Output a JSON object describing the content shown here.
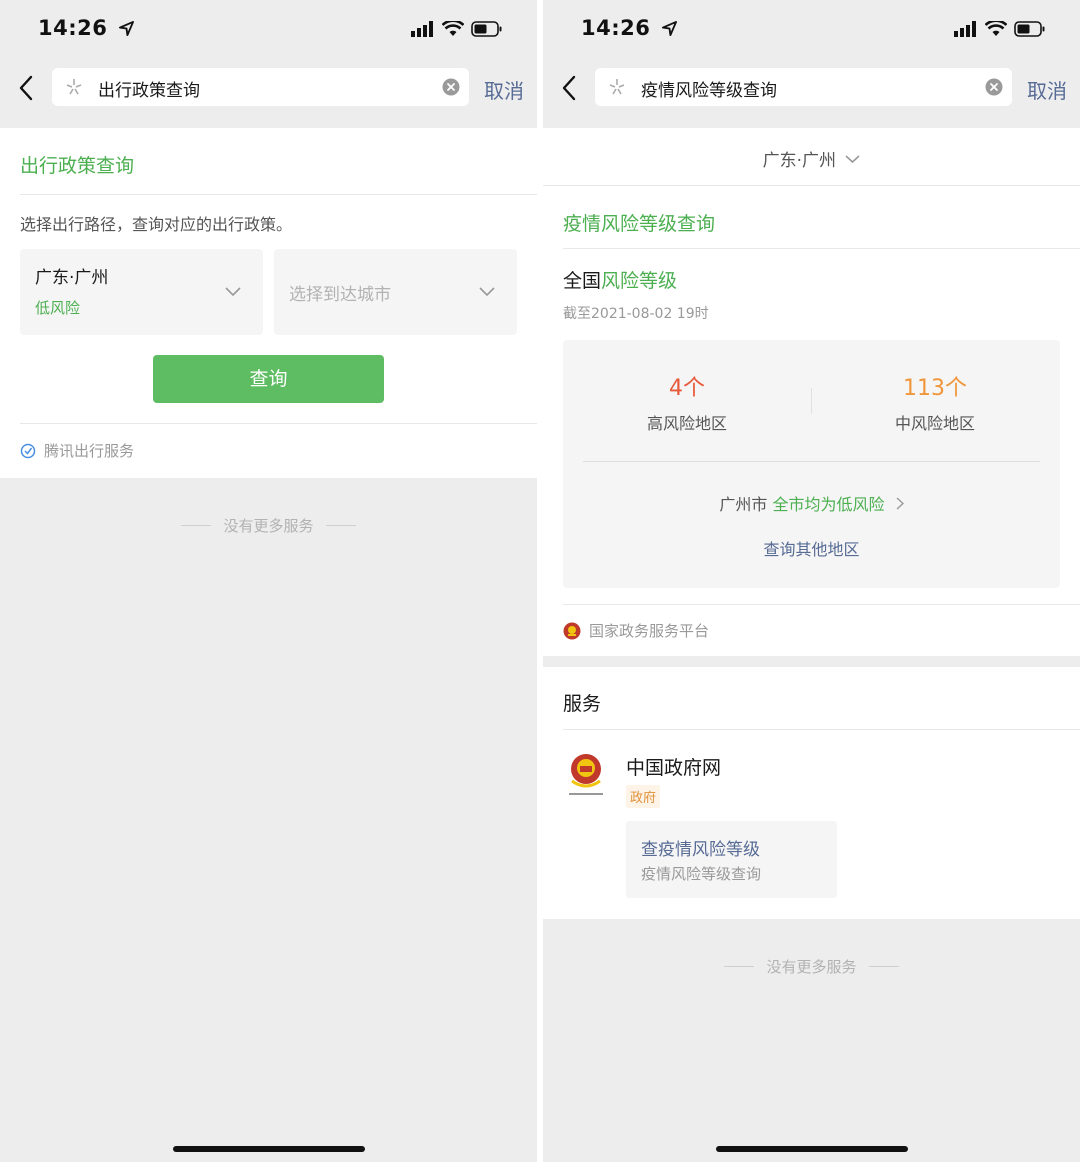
{
  "status_bar": {
    "time": "14:26"
  },
  "colors": {
    "accent_green": "#4caf50",
    "button_green": "#5ebd63",
    "link_blue": "#576b95",
    "high_risk_red": "#e8593a",
    "mid_risk_orange": "#f0963a"
  },
  "left": {
    "search": {
      "query": "出行政策查询",
      "cancel_label": "取消"
    },
    "card": {
      "title": "出行政策查询",
      "description": "选择出行路径，查询对应的出行政策。",
      "origin": {
        "city": "广东·广州",
        "risk": "低风险"
      },
      "destination": {
        "placeholder": "选择到达城市"
      },
      "query_button": "查询",
      "source": "腾讯出行服务"
    },
    "no_more": "没有更多服务"
  },
  "right": {
    "search": {
      "query": "疫情风险等级查询",
      "cancel_label": "取消"
    },
    "location": "广东·广州",
    "card": {
      "title": "疫情风险等级查询",
      "nation_prefix": "全国",
      "nation_highlight": "风险等级",
      "as_of": "截至2021-08-02 19时",
      "high_risk": {
        "count": "4个",
        "label": "高风险地区"
      },
      "mid_risk": {
        "count": "113个",
        "label": "中风险地区"
      },
      "city_name": "广州市",
      "city_status": "全市均为低风险",
      "other_link": "查询其他地区",
      "source": "国家政务服务平台"
    },
    "services": {
      "title": "服务",
      "item": {
        "name": "中国政府网",
        "tag": "政府",
        "action_title": "查疫情风险等级",
        "action_subtitle": "疫情风险等级查询"
      }
    },
    "no_more": "没有更多服务"
  }
}
